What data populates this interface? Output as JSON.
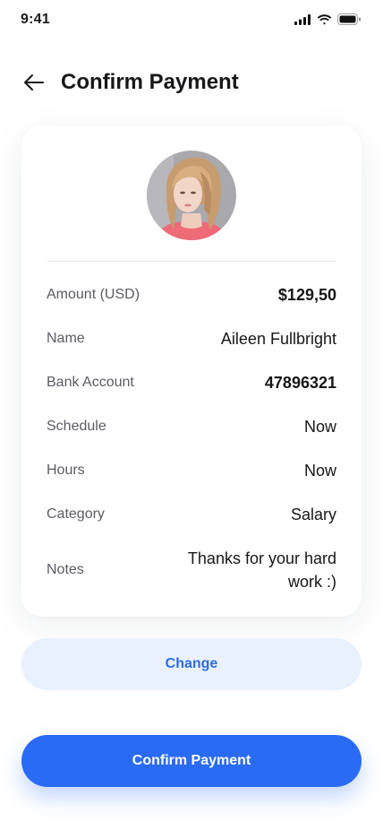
{
  "status_bar": {
    "time": "9:41",
    "icons": [
      "signal-icon",
      "wifi-icon",
      "battery-icon"
    ]
  },
  "header": {
    "back_icon": "arrow-left-icon",
    "title": "Confirm Payment"
  },
  "details": [
    {
      "label": "Amount (USD)",
      "value": "$129,50"
    },
    {
      "label": "Name",
      "value": "Aileen Fullbright"
    },
    {
      "label": "Bank Account",
      "value": "47896321"
    },
    {
      "label": "Schedule",
      "value": "Now"
    },
    {
      "label": "Hours",
      "value": "Now"
    },
    {
      "label": "Category",
      "value": "Salary"
    },
    {
      "label": "Notes",
      "value": "Thanks for your hard work :)"
    }
  ],
  "actions": {
    "change_label": "Change",
    "confirm_label": "Confirm Payment"
  },
  "colors": {
    "primary": "#2a6bf6",
    "secondary_bg": "#e9f1fe",
    "secondary_text": "#2b6de5"
  }
}
